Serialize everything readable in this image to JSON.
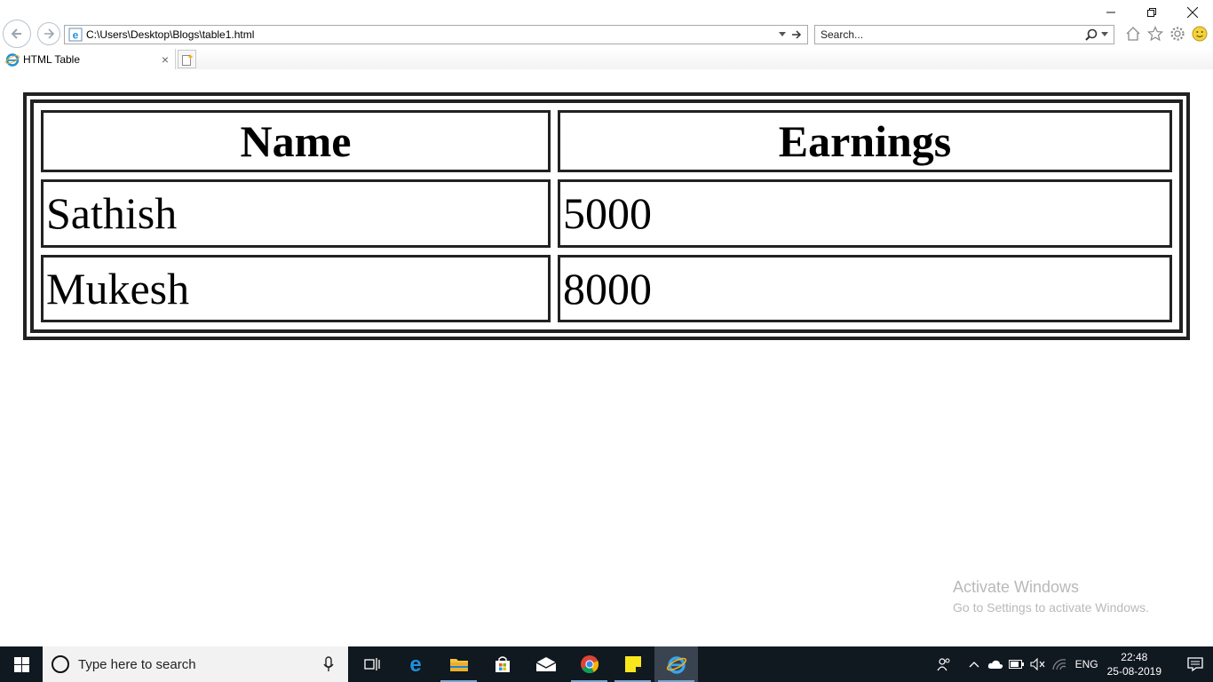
{
  "window": {
    "minimize_glyph": "—",
    "restore_glyph": "❐",
    "close_glyph": "✕"
  },
  "addressbar": {
    "url": "C:\\Users\\Desktop\\Blogs\\table1.html"
  },
  "searchbar": {
    "placeholder": "Search..."
  },
  "tab": {
    "title": "HTML Table",
    "close_glyph": "×"
  },
  "table": {
    "headers": [
      "Name",
      "Earnings"
    ],
    "rows": [
      [
        "Sathish",
        "5000"
      ],
      [
        "Mukesh",
        "8000"
      ]
    ]
  },
  "watermark": {
    "line1": "Activate Windows",
    "line2": "Go to Settings to activate Windows."
  },
  "taskbar": {
    "search_placeholder": "Type here to search",
    "apps": [
      "task-view",
      "edge",
      "file-explorer",
      "store",
      "mail",
      "chrome",
      "sticky-notes",
      "internet-explorer"
    ]
  },
  "tray": {
    "language": "ENG",
    "time": "22:48",
    "date": "25-08-2019"
  },
  "colors": {
    "taskbar": "#101820",
    "ie_blue": "#1e90d8",
    "table_border": "#222222"
  }
}
